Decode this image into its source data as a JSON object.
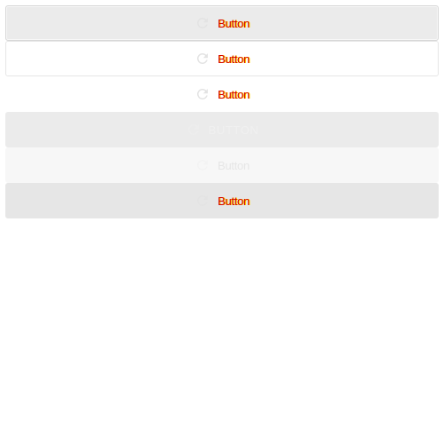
{
  "buttons": [
    {
      "icon": "refresh-icon",
      "label": "Button"
    },
    {
      "icon": "refresh-icon",
      "label": "Button"
    },
    {
      "icon": "refresh-icon",
      "label": "Button"
    },
    {
      "icon": "refresh-icon",
      "label": "BUTTON"
    },
    {
      "icon": "refresh-icon",
      "label": "Button"
    },
    {
      "icon": "refresh-icon",
      "label": "Button"
    }
  ],
  "colors": {
    "label_red": "#d40000",
    "label_yellow": "#ffd800",
    "button_gray": "#ebebeb",
    "button_light": "#f7f7f7",
    "button_dark": "#e6e6e6",
    "border_gray": "#d7d7d7",
    "page_bg": "#ffffff"
  }
}
